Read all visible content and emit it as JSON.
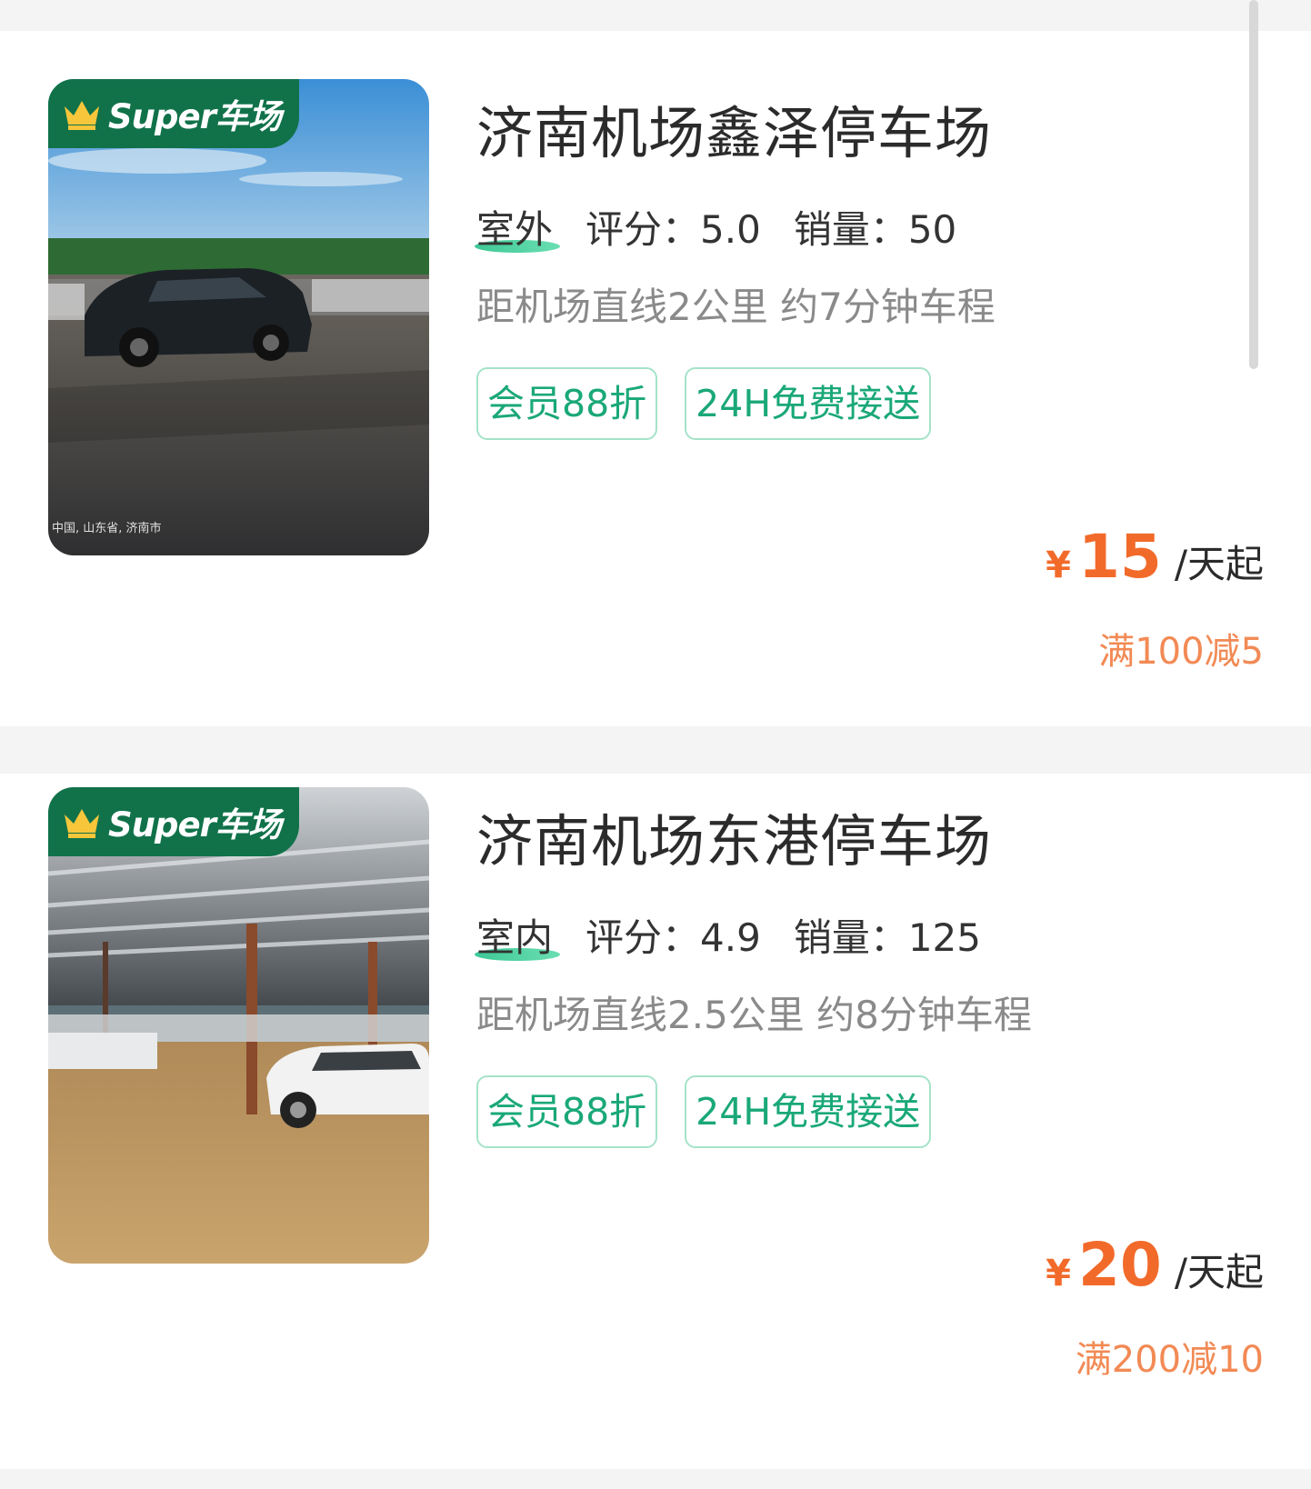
{
  "listings": [
    {
      "badge_text": "Super车场",
      "watermark": "中国, 山东省, 济南市",
      "title": "济南机场鑫泽停车场",
      "environment": "室外",
      "rating_label": "评分：5.0",
      "sales_label": "销量：50",
      "distance": "距机场直线2公里 约7分钟车程",
      "tags": [
        "会员88折",
        "24H免费接送"
      ],
      "price_currency": "¥",
      "price_value": "15",
      "price_unit": "/天起",
      "promo": "满100减5"
    },
    {
      "badge_text": "Super车场",
      "title": "济南机场东港停车场",
      "environment": "室内",
      "rating_label": "评分：4.9",
      "sales_label": "销量：125",
      "distance": "距机场直线2.5公里 约8分钟车程",
      "tags": [
        "会员88折",
        "24H免费接送"
      ],
      "price_currency": "¥",
      "price_value": "20",
      "price_unit": "/天起",
      "promo": "满200减10"
    }
  ],
  "colors": {
    "brand_green": "#11724a",
    "tag_green": "#1aa878",
    "price_orange": "#f26a2a",
    "promo_orange": "#f28a55"
  },
  "icons": {
    "badge": "crown-icon"
  }
}
